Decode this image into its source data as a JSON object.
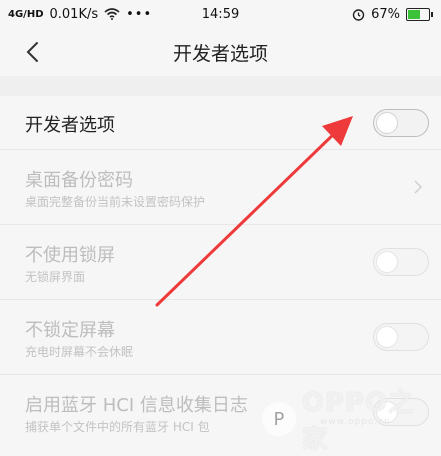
{
  "status_bar": {
    "left_text": "0.01K/s",
    "signal_label": "4G/HD",
    "time": "14:59",
    "battery": "67%",
    "battery_level": 0.67
  },
  "header": {
    "title": "开发者选项"
  },
  "settings": [
    {
      "title": "开发者选项",
      "subtitle": "",
      "control": "toggle",
      "on": false,
      "enabled": true
    },
    {
      "title": "桌面备份密码",
      "subtitle": "桌面完整备份当前未设置密码保护",
      "control": "chevron",
      "enabled": false
    },
    {
      "title": "不使用锁屏",
      "subtitle": "无锁屏界面",
      "control": "toggle",
      "on": false,
      "enabled": false
    },
    {
      "title": "不锁定屏幕",
      "subtitle": "充电时屏幕不会休眠",
      "control": "toggle",
      "on": false,
      "enabled": false
    },
    {
      "title": "启用蓝牙 HCI 信息收集日志",
      "subtitle": "捕获单个文件中的所有蓝牙 HCI 包",
      "control": "toggle",
      "on": false,
      "enabled": false
    }
  ],
  "watermark": {
    "brand": "OPPO之家",
    "url": "www.oppo.cn"
  },
  "colors": {
    "annotation_arrow": "#ee3a3a",
    "battery_fill": "#3cc13b"
  }
}
